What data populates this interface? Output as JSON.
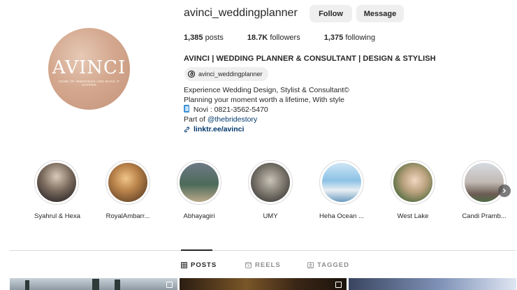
{
  "profile": {
    "username": "avinci_weddingplanner",
    "avatar_logo": "AVINCI",
    "avatar_logo_tagline": "HOME OF WEDDINGS AND MAKE IT HAPPEN",
    "follow_label": "Follow",
    "message_label": "Message",
    "posts_count": "1,385",
    "posts_label": "posts",
    "followers_count": "18.7K",
    "followers_label": "followers",
    "following_count": "1,375",
    "following_label": "following",
    "full_name": "AVINCI | WEDDING PLANNER & CONSULTANT | DESIGN & STYLISH",
    "threads_handle": "avinci_weddingplanner"
  },
  "bio": {
    "line1": "Experience Wedding Design, Stylist & Consultant©",
    "line2": "Planning your moment worth a lifetime, With style",
    "line3": " Novi : 0821-3562-5470",
    "line4_prefix": "Part of ",
    "mention": "@thebridestory",
    "link": "linktr.ee/avinci"
  },
  "highlights": [
    {
      "label": "Syahrul & Hexa"
    },
    {
      "label": "RoyalAmbarr..."
    },
    {
      "label": "Abhayagiri"
    },
    {
      "label": "UMY"
    },
    {
      "label": "Heha Ocean ..."
    },
    {
      "label": "West Lake"
    },
    {
      "label": "Candi Pramb..."
    }
  ],
  "tabs": {
    "posts": "POSTS",
    "reels": "REELS",
    "tagged": "TAGGED"
  },
  "colors": {
    "accent_link": "#00376b",
    "button_bg": "#efefef",
    "text_primary": "#262626",
    "text_muted": "#8e8e8e"
  },
  "icons": {
    "threads": "threads-icon",
    "phone": "phone-icon",
    "link": "link-icon",
    "next": "chevron-right-icon",
    "posts": "grid-icon",
    "reels": "reels-icon",
    "tagged": "tagged-icon"
  }
}
